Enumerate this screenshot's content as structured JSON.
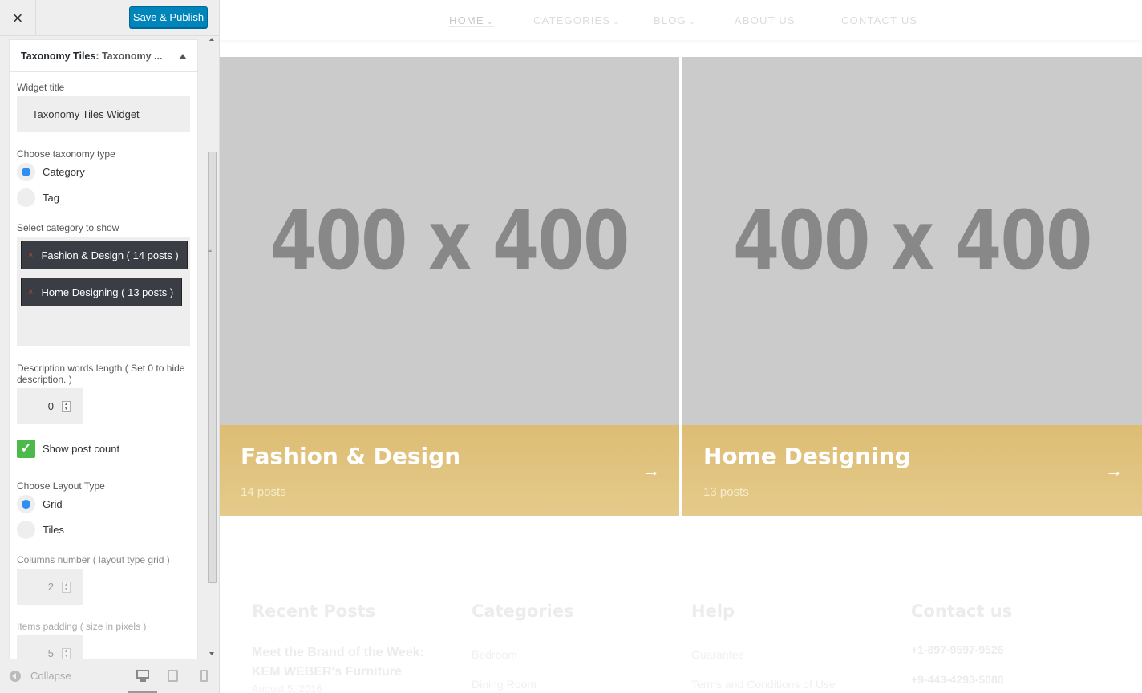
{
  "sidebar": {
    "close_icon": "×",
    "publish_label": "Save & Publish",
    "widget": {
      "title_bold": "Taxonomy Tiles:",
      "title_rest": " Taxonomy ...",
      "widget_title_label": "Widget title",
      "widget_title_value": "Taxonomy Tiles Widget",
      "taxonomy_label": "Choose taxonomy type",
      "taxonomy_options": [
        "Category",
        "Tag"
      ],
      "taxonomy_selected": "Category",
      "category_label": "Select category to show",
      "selected_categories": [
        "Fashion & Design ( 14 posts )",
        "Home Designing ( 13 posts )"
      ],
      "chip_remove": "×",
      "desc_label": "Description words length ( Set 0 to hide description. )",
      "desc_value": "0",
      "show_count_label": "Show post count",
      "show_count_checked": true,
      "check_glyph": "✓",
      "layout_label": "Choose Layout Type",
      "layout_options": [
        "Grid",
        "Tiles"
      ],
      "layout_selected": "Grid",
      "columns_label": "Columns number ( layout type grid )",
      "columns_value": "2",
      "padding_label": "Items padding ( size in pixels )",
      "padding_value": "5"
    },
    "collapse_label": "Collapse"
  },
  "preview": {
    "nav": [
      {
        "label": "HOME",
        "has_dropdown": true,
        "active": true
      },
      {
        "label": "CATEGORIES",
        "has_dropdown": true,
        "active": false
      },
      {
        "label": "BLOG",
        "has_dropdown": true,
        "active": false
      },
      {
        "label": "ABOUT US",
        "has_dropdown": false,
        "active": false
      },
      {
        "label": "CONTACT US",
        "has_dropdown": false,
        "active": false
      }
    ],
    "chevron": "⌄",
    "tiles": [
      {
        "placeholder": "400 x 400",
        "title": "Fashion & Design",
        "count": "14 posts"
      },
      {
        "placeholder": "400 x 400",
        "title": "Home Designing",
        "count": "13 posts"
      }
    ],
    "tile_arrow": "→",
    "footer": {
      "recent_posts": {
        "heading": "Recent Posts",
        "post_line1": "Meet the Brand of the Week:",
        "post_line2": "KEM WEBER's Furniture",
        "post_meta": "August 5, 2016"
      },
      "categories": {
        "heading": "Categories",
        "items": [
          "Bedroom",
          "Dining Room"
        ]
      },
      "help": {
        "heading": "Help",
        "items": [
          "Guarantee",
          "Terms and Conditions of Use"
        ]
      },
      "contact": {
        "heading": "Contact us",
        "phones": [
          "+1-897-9597-9526",
          "+9-443-4293-5080"
        ]
      }
    }
  },
  "colors": {
    "publish": "#0085ba",
    "radio_checked": "#2e8ff0",
    "checkbox": "#4cb94a",
    "tile_bar": "#ddbd73",
    "chip": "#3a3d44"
  }
}
